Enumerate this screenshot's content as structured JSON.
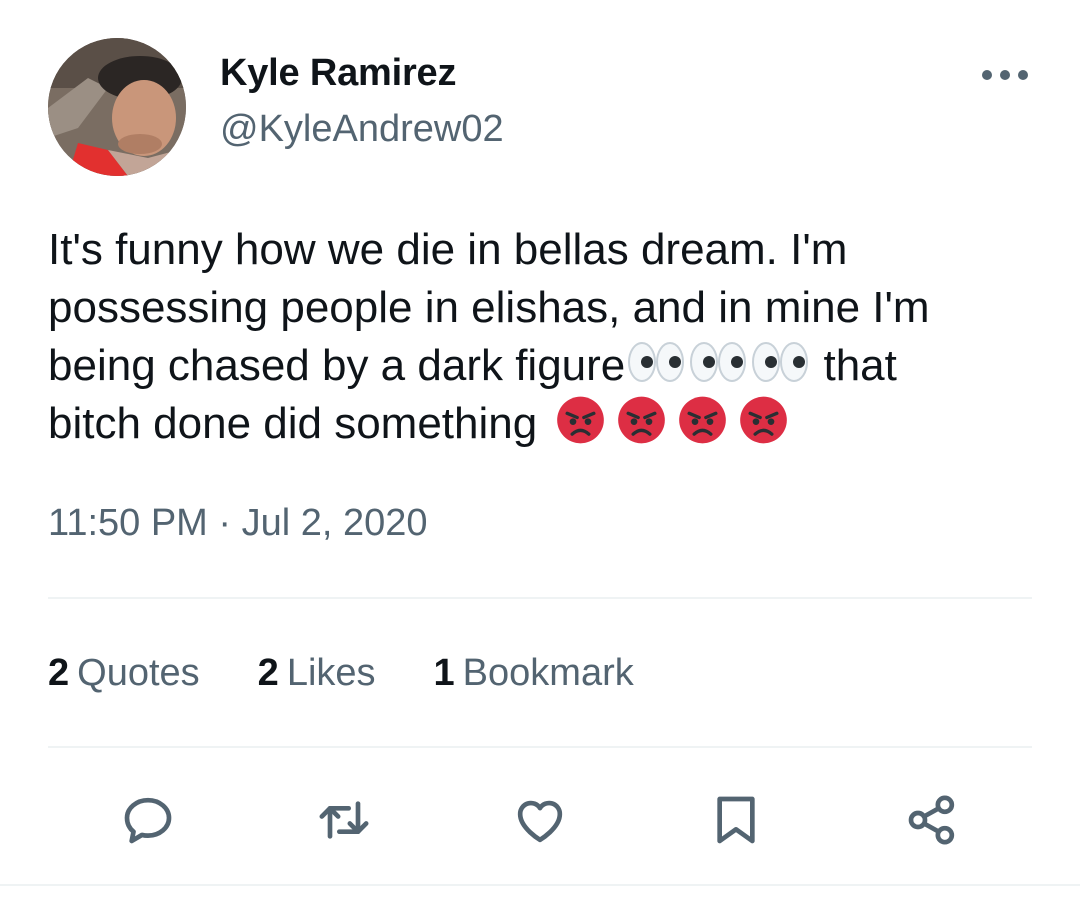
{
  "author": {
    "display_name": "Kyle Ramirez",
    "handle": "@KyleAndrew02"
  },
  "tweet": {
    "lines": [
      {
        "text": "It's funny how we die in bellas dream. I'm"
      },
      {
        "text": "possessing people in elishas, and in mine I'm"
      },
      {
        "text_before": "being chased by a dark figure",
        "emojis": [
          "eyes-emoji",
          "eyes-emoji",
          "eyes-emoji"
        ],
        "text_after": " that"
      },
      {
        "text_before": "bitch done did something ",
        "emojis": [
          "angry-face-emoji",
          "angry-face-emoji",
          "angry-face-emoji",
          "angry-face-emoji"
        ]
      }
    ]
  },
  "timestamp": "11:50 PM · Jul 2, 2020",
  "stats": {
    "quotes": {
      "count": "2",
      "label": "Quotes"
    },
    "likes": {
      "count": "2",
      "label": "Likes"
    },
    "bookmarks": {
      "count": "1",
      "label": "Bookmark"
    }
  },
  "actions": [
    "reply-icon",
    "retweet-icon",
    "like-icon",
    "bookmark-icon",
    "share-icon"
  ],
  "colors": {
    "text_primary": "#0f1419",
    "text_secondary": "#536471",
    "divider": "#eff3f4",
    "angry_emoji": "#dd2e44"
  }
}
